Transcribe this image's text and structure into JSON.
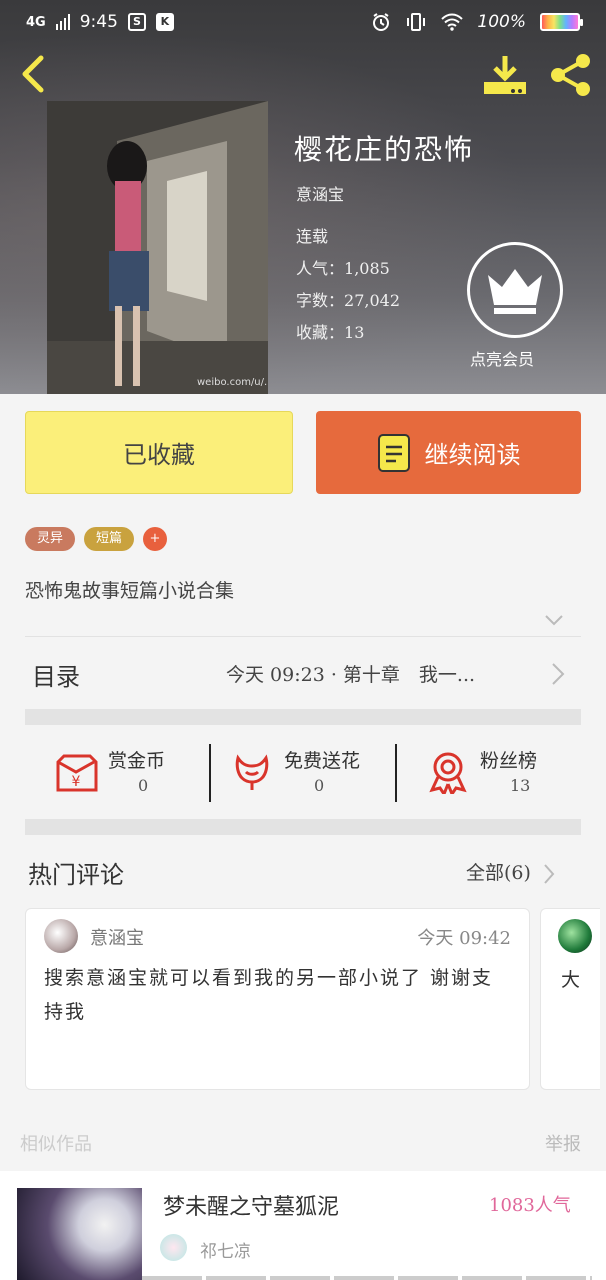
{
  "status_bar": {
    "network": "4G",
    "time": "9:45",
    "battery_text": "100%"
  },
  "book": {
    "title": "樱花庄的恐怖",
    "author": "意涵宝",
    "status": "连载",
    "popularity_label": "人气：",
    "popularity": "1,085",
    "wordcount_label": "字数：",
    "wordcount": "27,042",
    "favorites_label": "收藏：",
    "favorites": "13",
    "vip_label": "点亮会员"
  },
  "actions": {
    "favorited_label": "已收藏",
    "continue_label": "继续阅读"
  },
  "tags": [
    "灵异",
    "短篇",
    "+"
  ],
  "description": "恐怖鬼故事短篇小说合集",
  "toc": {
    "title": "目录",
    "latest": "今天 09:23 · 第十章　我一..."
  },
  "stats": [
    {
      "name": "赏金币",
      "value": "0"
    },
    {
      "name": "免费送花",
      "value": "0"
    },
    {
      "name": "粉丝榜",
      "value": "13"
    }
  ],
  "comments": {
    "title": "热门评论",
    "all_label": "全部(6)",
    "items": [
      {
        "user": "意涵宝",
        "time": "今天 09:42",
        "text": "搜索意涵宝就可以看到我的另一部小说了 谢谢支持我"
      },
      {
        "partial_text": "大"
      }
    ]
  },
  "similar": {
    "title": "相似作品",
    "report_label": "举报",
    "items": [
      {
        "title": "梦未醒之守墓狐泥",
        "popularity": "1083人气",
        "author": "祁七凉"
      }
    ]
  },
  "colors": {
    "yellow_button": "#fbef7a",
    "orange_button": "#e66a3d",
    "accent_red": "#d9342b",
    "tag_lingyi": "#c97a5f",
    "tag_duanpian": "#c9a23e",
    "tag_plus": "#e8603d",
    "pink_popularity": "#e0679a"
  },
  "cover_watermark": "weibo.com/u/..."
}
